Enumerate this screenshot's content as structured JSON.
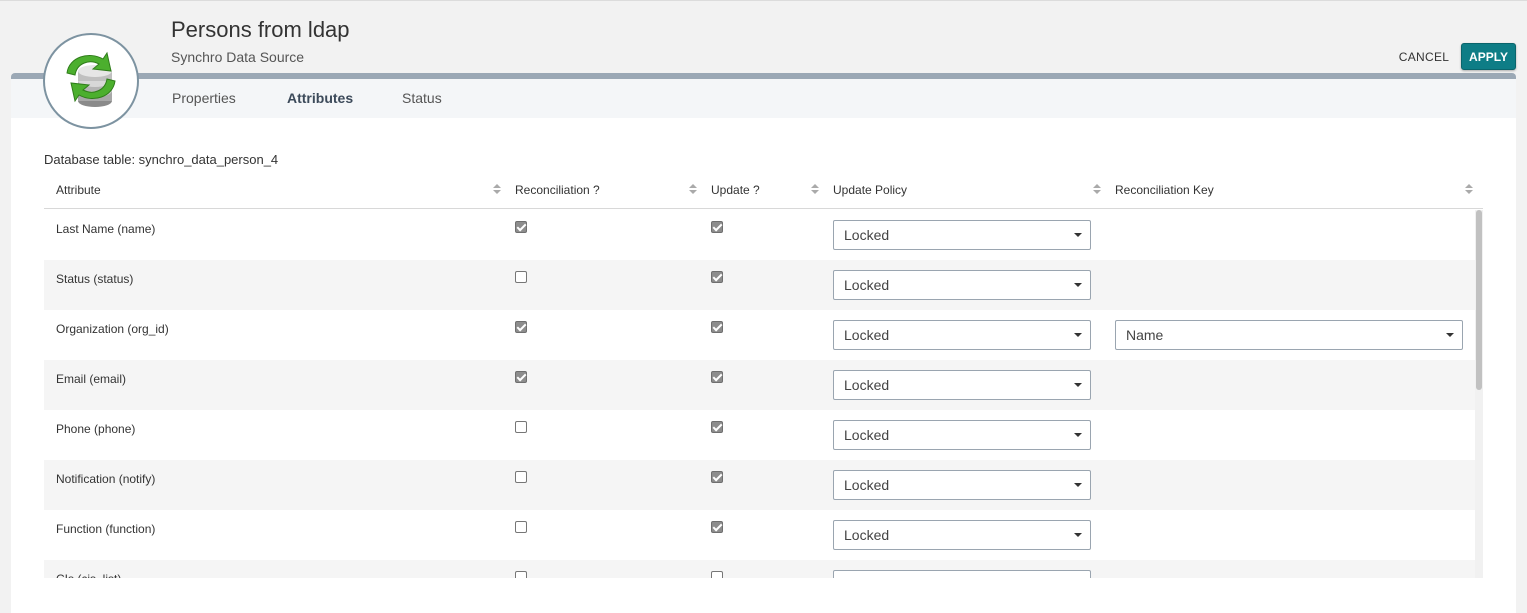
{
  "header": {
    "title": "Persons from ldap",
    "subtitle": "Synchro Data Source",
    "cancel_label": "CANCEL",
    "apply_label": "APPLY"
  },
  "tabs": [
    {
      "label": "Properties",
      "active": false
    },
    {
      "label": "Attributes",
      "active": true
    },
    {
      "label": "Status",
      "active": false
    }
  ],
  "database_table": "Database table: synchro_data_person_4",
  "table": {
    "columns": [
      "Attribute",
      "Reconciliation ?",
      "Update ?",
      "Update Policy",
      "Reconciliation Key"
    ],
    "rows": [
      {
        "attribute": "Last Name (name)",
        "reconciliation": true,
        "update": true,
        "policy": "Locked",
        "key": ""
      },
      {
        "attribute": "Status (status)",
        "reconciliation": false,
        "update": true,
        "policy": "Locked",
        "key": ""
      },
      {
        "attribute": "Organization (org_id)",
        "reconciliation": true,
        "update": true,
        "policy": "Locked",
        "key": "Name"
      },
      {
        "attribute": "Email (email)",
        "reconciliation": true,
        "update": true,
        "policy": "Locked",
        "key": ""
      },
      {
        "attribute": "Phone (phone)",
        "reconciliation": false,
        "update": true,
        "policy": "Locked",
        "key": ""
      },
      {
        "attribute": "Notification (notify)",
        "reconciliation": false,
        "update": true,
        "policy": "Locked",
        "key": ""
      },
      {
        "attribute": "Function (function)",
        "reconciliation": false,
        "update": true,
        "policy": "Locked",
        "key": ""
      },
      {
        "attribute": "CIs (cis_list)",
        "reconciliation": false,
        "update": false,
        "policy": "",
        "key": ""
      }
    ]
  },
  "colors": {
    "accent": "#0e7d86",
    "panel_border": "#9ba8b5",
    "row_alt": "#f5f5f5"
  },
  "icons": {
    "logo": "synchro-database-icon",
    "select": "caret-down-icon",
    "sort": "sort-icon"
  }
}
